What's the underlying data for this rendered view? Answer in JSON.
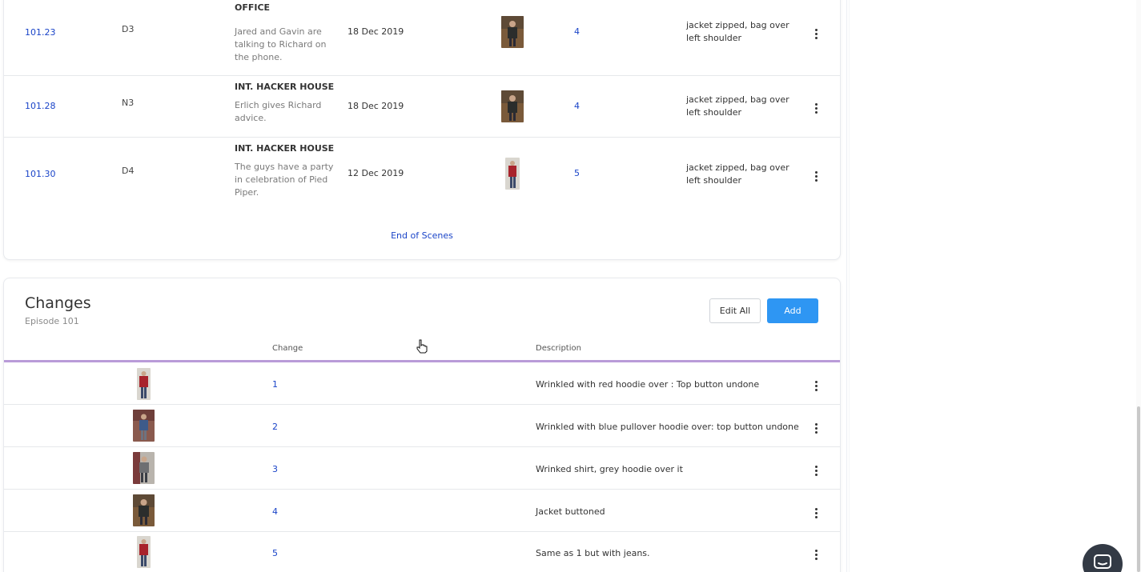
{
  "scenes": {
    "rows": [
      {
        "number": "101.23",
        "code": "D3",
        "heading": "INT. GAVIN BELSON'S OFFICE",
        "description": "Jared and Gavin are talking to Richard on the phone.",
        "date": "18 Dec 2019",
        "look": "4",
        "note": "jacket zipped, bag over left shoulder",
        "thumb_icon": "character-photo-dark-jacket"
      },
      {
        "number": "101.28",
        "code": "N3",
        "heading": "INT. HACKER HOUSE",
        "description": "Erlich gives Richard advice.",
        "date": "18 Dec 2019",
        "look": "4",
        "note": "jacket zipped, bag over left shoulder",
        "thumb_icon": "character-photo-dark-jacket"
      },
      {
        "number": "101.30",
        "code": "D4",
        "heading": "INT. HACKER HOUSE",
        "description": "The guys have a party in celebration of Pied Piper.",
        "date": "12 Dec 2019",
        "look": "5",
        "note": "jacket zipped, bag over left shoulder",
        "thumb_icon": "character-photo-red-hoodie"
      }
    ],
    "end_label": "End of Scenes"
  },
  "changes": {
    "title": "Changes",
    "subtitle": "Episode 101",
    "edit_all_label": "Edit All",
    "add_label": "Add",
    "columns": {
      "change": "Change",
      "description": "Description"
    },
    "rows": [
      {
        "number": "1",
        "description": "Wrinkled with red hoodie over : Top button undone",
        "thumb_icon": "character-photo-red-hoodie"
      },
      {
        "number": "2",
        "description": "Wrinkled with blue pullover hoodie over: top button undone",
        "thumb_icon": "character-photo-blue-hoodie"
      },
      {
        "number": "3",
        "description": "Wrinked shirt, grey hoodie over it",
        "thumb_icon": "character-photo-grey-hoodie"
      },
      {
        "number": "4",
        "description": "Jacket buttoned",
        "thumb_icon": "character-photo-dark-jacket"
      },
      {
        "number": "5",
        "description": "Same as 1 but with jeans.",
        "thumb_icon": "character-photo-red-hoodie"
      }
    ]
  },
  "colors": {
    "link": "#1a44c8",
    "accent_button": "#2e96f3",
    "header_underline": "#b99bd8"
  }
}
